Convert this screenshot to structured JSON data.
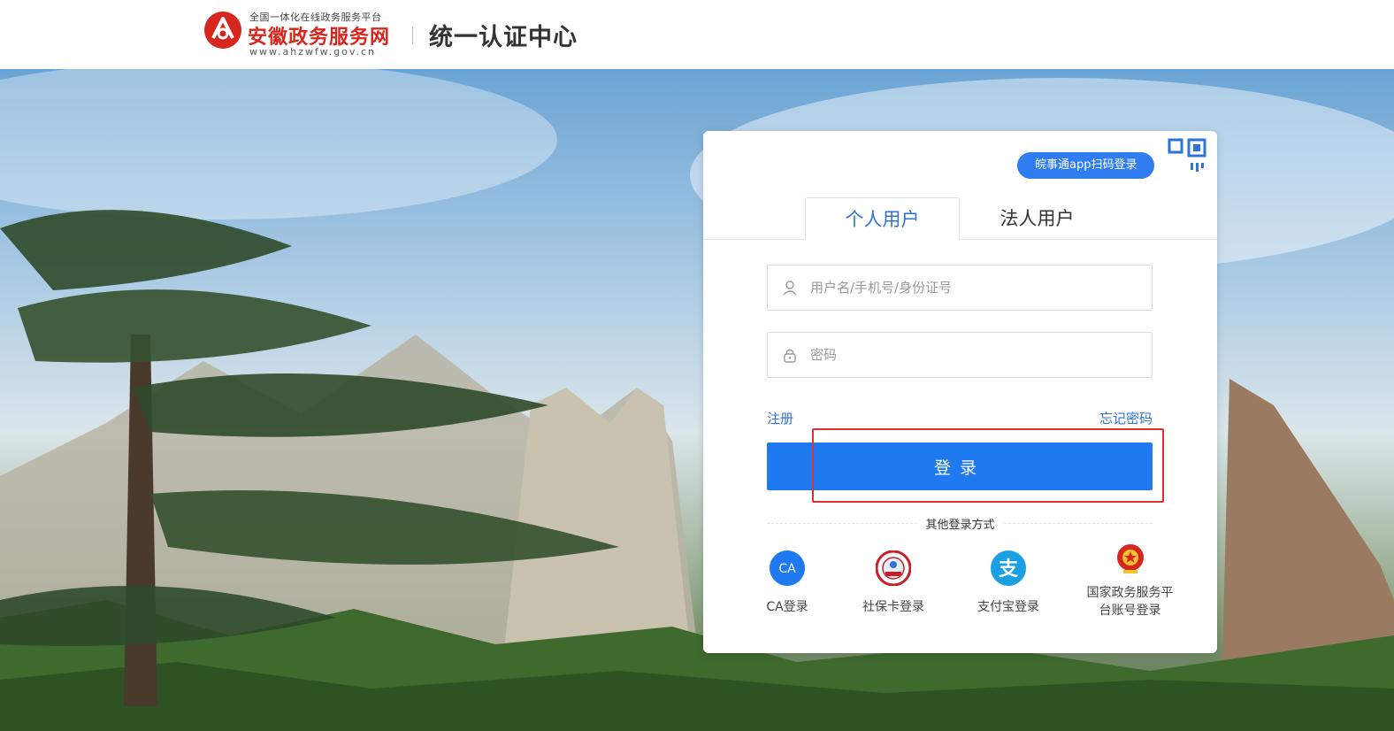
{
  "header": {
    "logo_small": "全国一体化在线政务服务平台",
    "logo_main": "安徽政务服务网",
    "logo_url": "www.ahzwfw.gov.cn",
    "title": "统一认证中心"
  },
  "login": {
    "scan_label": "皖事通app扫码登录",
    "tabs": [
      {
        "label": "个人用户",
        "active": true
      },
      {
        "label": "法人用户",
        "active": false
      }
    ],
    "username_placeholder": "用户名/手机号/身份证号",
    "password_placeholder": "密码",
    "register_label": "注册",
    "forgot_label": "忘记密码",
    "submit_label": "登录",
    "other_title": "其他登录方式",
    "alt_methods": [
      {
        "label": "CA登录",
        "icon": "ca-icon",
        "icon_text": "CA"
      },
      {
        "label": "社保卡登录",
        "icon": "social-security-card-icon"
      },
      {
        "label": "支付宝登录",
        "icon": "alipay-icon",
        "icon_text": "支"
      },
      {
        "label": "国家政务服务平台账号登录",
        "icon": "national-emblem-icon"
      }
    ]
  },
  "colors": {
    "brand_red": "#d7261e",
    "primary_blue": "#1f79f0",
    "link_blue": "#2f73d6",
    "highlight_red": "#e0322d"
  }
}
